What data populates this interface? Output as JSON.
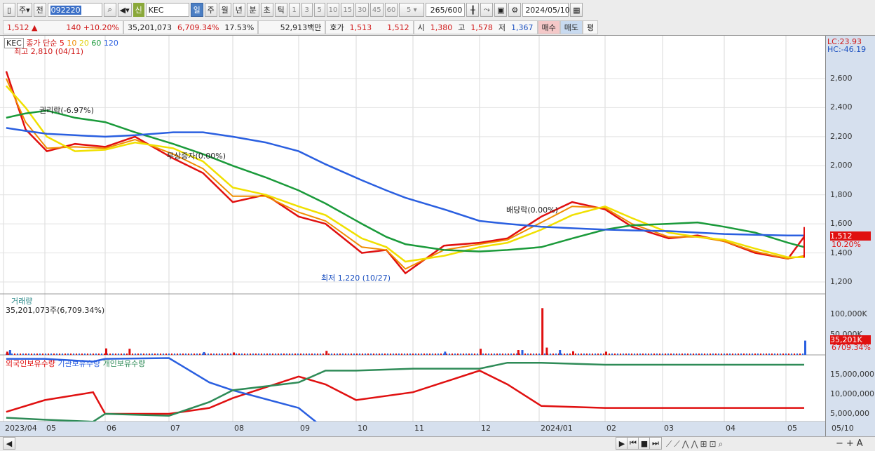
{
  "toolbar": {
    "period_type": "주",
    "prev_label": "전",
    "stock_code": "092220",
    "stock_name_tag": "신",
    "stock_name": "KEC",
    "periods": [
      "일",
      "주",
      "월",
      "년",
      "분",
      "초",
      "틱"
    ],
    "active_period": "일",
    "intervals": [
      "1",
      "3",
      "5",
      "10",
      "15",
      "30",
      "45",
      "60"
    ],
    "interval_select": "5",
    "bar_count": "265",
    "bar_total": "/600",
    "date": "2024/05/10"
  },
  "quote": {
    "price": "1,512",
    "price_arrow": "▲",
    "change": "140",
    "change_pct": "+10.20%",
    "volume": "35,201,073",
    "volume_pct": "6,709.34%",
    "turnover": "17.53%",
    "amount": "52,913백만",
    "ask_label": "호가",
    "ask": "1,513",
    "bid": "1,512",
    "open_label": "시",
    "open": "1,380",
    "high_label": "고",
    "high": "1,578",
    "low_label": "저",
    "low": "1,367",
    "buy_label": "매수",
    "sell_label": "매도",
    "avg_label": "평"
  },
  "legend": {
    "name": "KEC",
    "ma_label": "종가 단순",
    "ma": [
      "5",
      "10",
      "20",
      "60",
      "120"
    ],
    "ma_colors": [
      "#e01010",
      "#f08c00",
      "#f0e000",
      "#1a9a3a",
      "#2a5fe0"
    ],
    "high_note": "최고 2,810 (04/11)",
    "low_note": "최저 1,220 (10/27)",
    "note1": "권리락(-6.97%)",
    "note2": "무상증자(0.00%)",
    "note3": "배당락(0.00%)",
    "lc": "LC:23.93",
    "hc": "HC:-46.19"
  },
  "price_axis": {
    "ticks": [
      "2,600",
      "2,400",
      "2,200",
      "2,000",
      "1,800",
      "1,600",
      "1,400",
      "1,200"
    ],
    "last": "1,512",
    "last_pct": "10.20%"
  },
  "volume_panel": {
    "title": "거래량",
    "info": "35,201,073주(6,709.34%)",
    "ticks": [
      "100,000K",
      "50,000K"
    ],
    "last": "35,201K",
    "last_pct": "6709.34%"
  },
  "holdings_panel": {
    "series": [
      "외국인보유수량",
      "기관보유수량",
      "개인보유수량"
    ],
    "colors": [
      "#e01010",
      "#2a5fe0",
      "#2e8b57"
    ],
    "ticks": [
      "15,000,000",
      "10,000,000",
      "5,000,000"
    ]
  },
  "xaxis": {
    "labels": [
      "2023/04",
      "05",
      "06",
      "07",
      "08",
      "09",
      "10",
      "11",
      "12",
      "2024/01",
      "02",
      "03",
      "04",
      "05"
    ],
    "last": "05/10"
  },
  "chart_data": {
    "type": "line",
    "ylim": [
      1150,
      2850
    ],
    "dates": [
      "2023-04-03",
      "2023-04-17",
      "2023-05-02",
      "2023-05-16",
      "2023-06-01",
      "2023-06-15",
      "2023-07-03",
      "2023-07-17",
      "2023-08-01",
      "2023-08-16",
      "2023-09-01",
      "2023-09-15",
      "2023-10-04",
      "2023-10-17",
      "2023-10-27",
      "2023-11-15",
      "2023-12-01",
      "2023-12-15",
      "2024-01-02",
      "2024-01-16",
      "2024-02-01",
      "2024-02-15",
      "2024-03-04",
      "2024-03-18",
      "2024-04-01",
      "2024-04-16",
      "2024-05-02",
      "2024-05-10"
    ],
    "series": [
      {
        "name": "5",
        "values": [
          2650,
          2250,
          2100,
          2150,
          2130,
          2200,
          2050,
          1950,
          1750,
          1800,
          1650,
          1600,
          1400,
          1420,
          1260,
          1450,
          1470,
          1500,
          1650,
          1750,
          1700,
          1580,
          1500,
          1520,
          1480,
          1400,
          1360,
          1512
        ]
      },
      {
        "name": "10",
        "values": [
          2600,
          2300,
          2120,
          2130,
          2120,
          2180,
          2080,
          1980,
          1790,
          1790,
          1680,
          1620,
          1440,
          1420,
          1290,
          1420,
          1460,
          1490,
          1610,
          1720,
          1710,
          1600,
          1510,
          1510,
          1480,
          1410,
          1360,
          1380
        ]
      },
      {
        "name": "20",
        "values": [
          2550,
          2400,
          2200,
          2100,
          2110,
          2160,
          2120,
          2030,
          1850,
          1800,
          1720,
          1660,
          1500,
          1440,
          1340,
          1380,
          1440,
          1470,
          1560,
          1660,
          1720,
          1640,
          1540,
          1510,
          1490,
          1430,
          1370,
          1370
        ]
      },
      {
        "name": "60",
        "values": [
          2330,
          2360,
          2380,
          2330,
          2300,
          2230,
          2150,
          2080,
          2000,
          1920,
          1830,
          1740,
          1600,
          1510,
          1460,
          1420,
          1410,
          1420,
          1440,
          1500,
          1560,
          1590,
          1600,
          1610,
          1580,
          1540,
          1470,
          1440
        ]
      },
      {
        "name": "120",
        "values": [
          2260,
          2240,
          2220,
          2210,
          2200,
          2210,
          2230,
          2230,
          2200,
          2160,
          2100,
          2010,
          1900,
          1830,
          1780,
          1700,
          1620,
          1600,
          1580,
          1570,
          1560,
          1555,
          1550,
          1540,
          1530,
          1525,
          1520,
          1520
        ]
      }
    ],
    "volume_k": {
      "dates": [
        "2023-04-03",
        "2023-04-05",
        "2023-06-01",
        "2023-06-12",
        "2023-07-17",
        "2023-08-01",
        "2023-09-15",
        "2023-11-15",
        "2023-12-01",
        "2023-12-20",
        "2023-12-22",
        "2024-01-02",
        "2024-01-04",
        "2024-01-10",
        "2024-01-16",
        "2024-02-01",
        "2024-05-10"
      ],
      "values": [
        8000,
        12000,
        16000,
        15000,
        7000,
        6000,
        10000,
        8000,
        15000,
        12000,
        12000,
        115000,
        18000,
        12000,
        9000,
        8000,
        35201
      ]
    },
    "holdings": {
      "dates": [
        "2023-04-03",
        "2023-05-01",
        "2023-05-25",
        "2023-06-01",
        "2023-07-01",
        "2023-07-20",
        "2023-08-01",
        "2023-09-01",
        "2023-09-15",
        "2023-10-01",
        "2023-11-01",
        "2023-12-01",
        "2023-12-15",
        "2024-01-02",
        "2024-02-01",
        "2024-03-01",
        "2024-04-01",
        "2024-05-10"
      ],
      "foreign": [
        5500,
        8500,
        10500,
        5000,
        5000,
        6500,
        9000,
        14500,
        12500,
        8500,
        10500,
        16000,
        12500,
        7000,
        6500,
        6500,
        6500,
        6500
      ],
      "institution": [
        19000,
        19000,
        18300,
        19000,
        19200,
        13000,
        11000,
        6500,
        1000,
        1000,
        1000,
        1000,
        1000,
        1000,
        800,
        800,
        800,
        1000
      ],
      "individual": [
        4000,
        3500,
        3000,
        5000,
        4500,
        8000,
        11000,
        13000,
        16000,
        16000,
        16500,
        16500,
        18000,
        18000,
        17500,
        17500,
        17500,
        17500
      ]
    }
  }
}
